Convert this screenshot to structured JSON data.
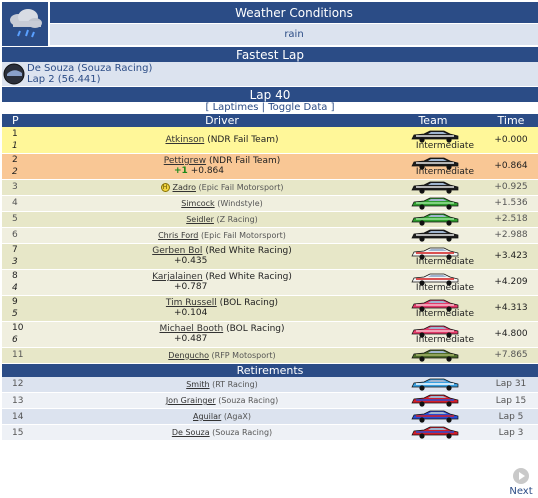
{
  "weather": {
    "title": "Weather Conditions",
    "value": "rain",
    "icon": "rain-cloud-icon"
  },
  "fastest_lap": {
    "title": "Fastest Lap",
    "driver_line": "De Souza (Souza Racing)",
    "lap_line": "Lap 2 (56.441)",
    "icon": "helmet-icon"
  },
  "lap": {
    "title": "Lap 40"
  },
  "links": {
    "open": "[",
    "laptimes": "Laptimes",
    "sep": "|",
    "toggle": "Toggle Data",
    "close": "]"
  },
  "headers": {
    "p": "P",
    "driver": "Driver",
    "team": "Team",
    "time": "Time"
  },
  "colors": {
    "header": "#2b4c86",
    "row_first": "#fff799",
    "row_second": "#f9c795",
    "row_odd": "#e7e7c8",
    "row_even": "#f0efdf",
    "row_ret_odd": "#dce3ef",
    "row_ret_even": "#eef1f6"
  },
  "rows": [
    {
      "pos": "1",
      "pos2": "1",
      "name": "Atkinson",
      "team": "(NDR Fail Team)",
      "gain": "",
      "gap": "",
      "tyre": "Intermediate",
      "time": "+0.000",
      "car": "black",
      "tall": true,
      "bg": "#fff799"
    },
    {
      "pos": "2",
      "pos2": "2",
      "name": "Pettigrew",
      "team": "(NDR Fail Team)",
      "gain": "+1",
      "gap": "+0.864",
      "tyre": "Intermediate",
      "time": "+0.864",
      "car": "black",
      "tall": true,
      "bg": "#f9c795"
    },
    {
      "pos": "3",
      "pos2": "",
      "name": "Zadro",
      "team": "(Epic Fail Motorsport)",
      "gain": "",
      "gap": "",
      "tyre": "",
      "time": "+0.925",
      "car": "black",
      "tall": false,
      "badge": "H",
      "bg": "#e7e7c8"
    },
    {
      "pos": "4",
      "pos2": "",
      "name": "Simcock",
      "team": "(Windstyle)",
      "gain": "",
      "gap": "",
      "tyre": "",
      "time": "+1.536",
      "car": "green",
      "tall": false,
      "bg": "#f0efdf"
    },
    {
      "pos": "5",
      "pos2": "",
      "name": "Seidler",
      "team": "(Z Racing)",
      "gain": "",
      "gap": "",
      "tyre": "",
      "time": "+2.518",
      "car": "green",
      "tall": false,
      "bg": "#e7e7c8"
    },
    {
      "pos": "6",
      "pos2": "",
      "name": "Chris Ford",
      "team": "(Epic Fail Motorsport)",
      "gain": "",
      "gap": "",
      "tyre": "",
      "time": "+2.988",
      "car": "black",
      "tall": false,
      "bg": "#f0efdf"
    },
    {
      "pos": "7",
      "pos2": "3",
      "name": "Gerben Bol",
      "team": "(Red White Racing)",
      "gain": "",
      "gap": "+0.435",
      "tyre": "Intermediate",
      "time": "+3.423",
      "car": "redwhite",
      "tall": true,
      "bg": "#e7e7c8"
    },
    {
      "pos": "8",
      "pos2": "4",
      "name": "Karjalainen",
      "team": "(Red White Racing)",
      "gain": "",
      "gap": "+0.787",
      "tyre": "Intermediate",
      "time": "+4.209",
      "car": "redwhite",
      "tall": true,
      "bg": "#f0efdf"
    },
    {
      "pos": "9",
      "pos2": "5",
      "name": "Tim Russell",
      "team": "(BOL Racing)",
      "gain": "",
      "gap": "+0.104",
      "tyre": "Intermediate",
      "time": "+4.313",
      "car": "pink",
      "tall": true,
      "bg": "#e7e7c8"
    },
    {
      "pos": "10",
      "pos2": "6",
      "name": "Michael Booth",
      "team": "(BOL Racing)",
      "gain": "",
      "gap": "+0.487",
      "tyre": "Intermediate",
      "time": "+4.800",
      "car": "pink",
      "tall": true,
      "bg": "#f0efdf"
    },
    {
      "pos": "11",
      "pos2": "",
      "name": "Dengucho",
      "team": "(RFP Motosport)",
      "gain": "",
      "gap": "",
      "tyre": "",
      "time": "+7.865",
      "car": "camo",
      "tall": false,
      "bg": "#e7e7c8"
    }
  ],
  "retirements": {
    "title": "Retirements",
    "rows": [
      {
        "pos": "12",
        "name": "Smith",
        "team": "(RT Racing)",
        "time": "Lap 31",
        "car": "bluewhite",
        "bg": "#dce3ef"
      },
      {
        "pos": "13",
        "name": "Jon Grainger",
        "team": "(Souza Racing)",
        "time": "Lap 15",
        "car": "redblue",
        "bg": "#eef1f6"
      },
      {
        "pos": "14",
        "name": "Aguilar",
        "team": "(AgaX)",
        "time": "Lap 5",
        "car": "blue",
        "bg": "#dce3ef"
      },
      {
        "pos": "15",
        "name": "De Souza",
        "team": "(Souza Racing)",
        "time": "Lap 3",
        "car": "redblue",
        "bg": "#eef1f6"
      }
    ]
  },
  "next": {
    "label": "Next"
  }
}
